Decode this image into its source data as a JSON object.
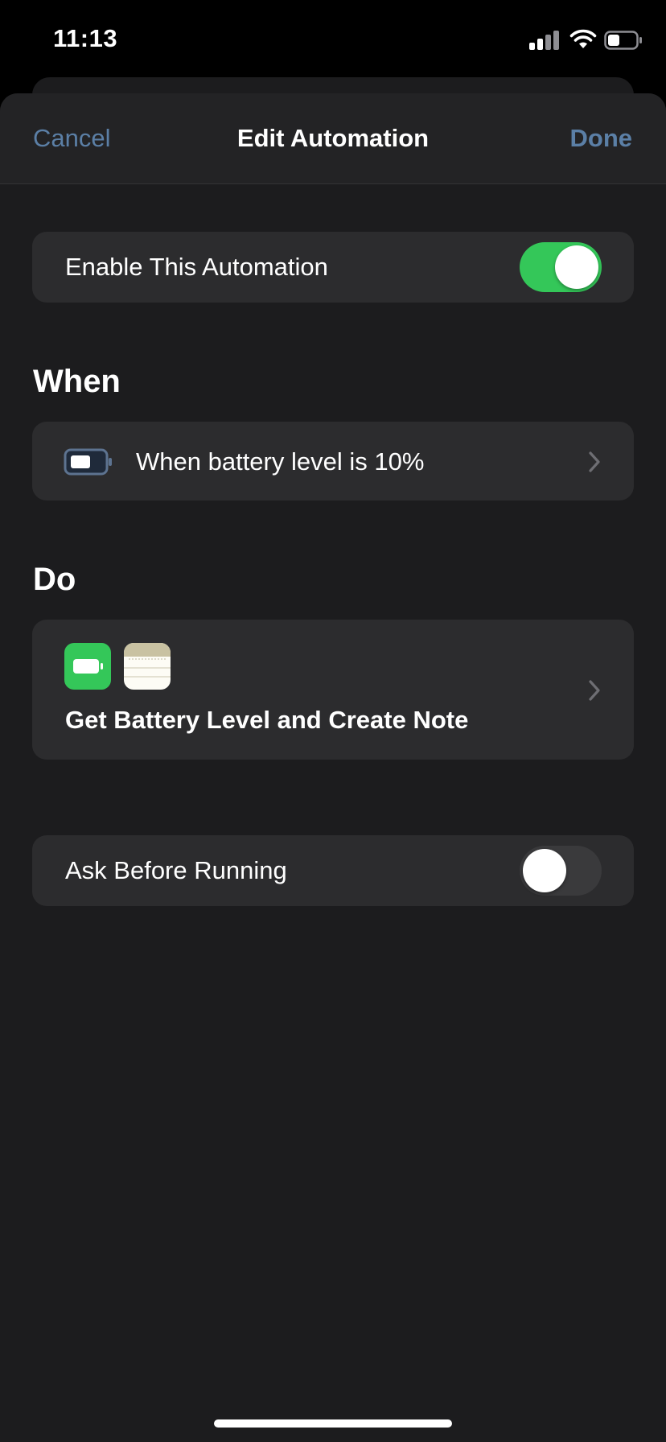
{
  "status_bar": {
    "time": "11:13",
    "icons": [
      "signal-icon",
      "wifi-icon",
      "battery-icon"
    ]
  },
  "nav": {
    "cancel_label": "Cancel",
    "title": "Edit Automation",
    "done_label": "Done"
  },
  "enable_row": {
    "label": "Enable This Automation",
    "enabled": true
  },
  "when_section": {
    "header": "When",
    "trigger_label": "When battery level is 10%",
    "icon": "battery-icon"
  },
  "do_section": {
    "header": "Do",
    "action_title": "Get Battery Level and Create Note",
    "icons": [
      "battery-app-icon",
      "notes-app-icon"
    ]
  },
  "ask_row": {
    "label": "Ask Before Running",
    "enabled": false
  },
  "colors": {
    "accent": "#5b7fa6",
    "toggle_on": "#34c759",
    "toggle_off": "#3a3a3c",
    "card": "#2c2c2e",
    "sheet": "#1c1c1e"
  }
}
